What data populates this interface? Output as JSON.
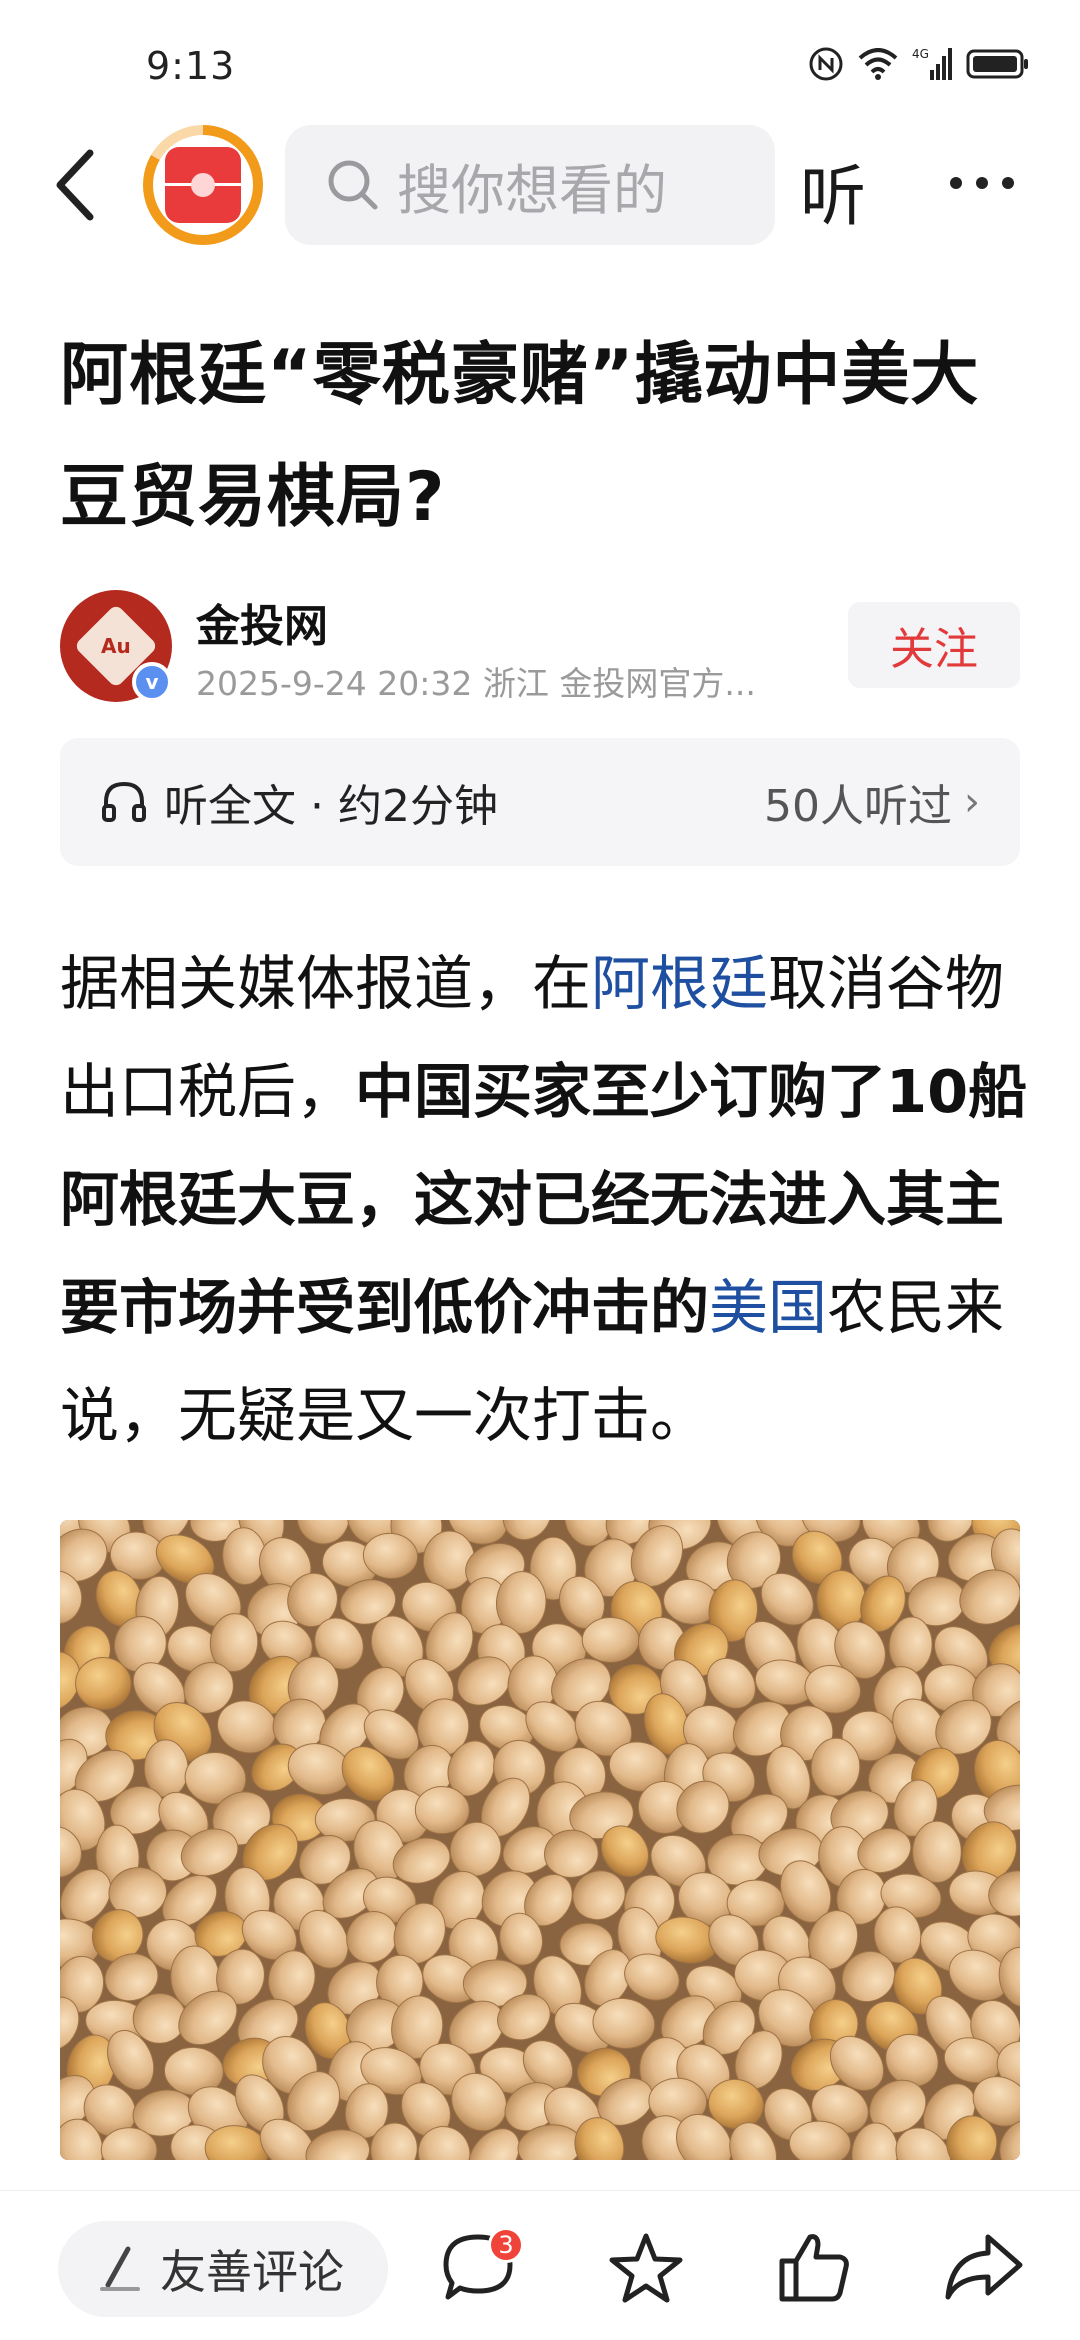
{
  "status_bar": {
    "time": "9:13"
  },
  "nav": {
    "search_placeholder": "搜你想看的",
    "listen_label": "听"
  },
  "article": {
    "title": "阿根廷“零税豪赌”撬动中美大豆贸易棋局?",
    "author": {
      "name": "金投网",
      "avatar_text": "Au",
      "meta": "2025-9-24  20:32  浙江  金投网官方...",
      "follow_label": "关注"
    },
    "listen": {
      "label": "听全文 · 约2分钟",
      "count": "50人听过"
    },
    "body": {
      "p1_a": "据相关媒体报道，在",
      "p1_link1": "阿根廷",
      "p1_b": "取消谷物出口税后，",
      "p1_bold": "中国买家至少订购了10船阿根廷大豆，这对已经无法进入其主要市场并受到低价冲击的",
      "p1_link2": "美国",
      "p1_c": "农民来说，无疑是又一次打击。"
    }
  },
  "bottom_bar": {
    "comment_placeholder": "友善评论",
    "comment_count": "3"
  },
  "colors": {
    "accent_red": "#e23a3a",
    "link_blue": "#1f4fa0",
    "badge_red": "#f0443a"
  }
}
